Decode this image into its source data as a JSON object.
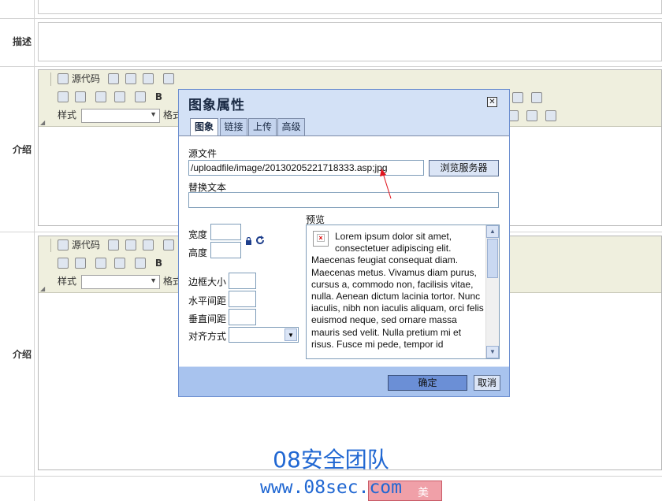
{
  "form": {
    "row_labels": [
      "描述",
      "介绍",
      "介绍"
    ],
    "editor_toolbar": {
      "source_label": "源代码",
      "bold_label": "B",
      "style_label": "样式",
      "format_label": "格式"
    }
  },
  "dialog": {
    "title": "图象属性",
    "close_symbol": "✕",
    "tabs": [
      "图象",
      "链接",
      "上传",
      "高级"
    ],
    "source_label": "源文件",
    "source_value": "/uploadfile/image/20130205221718333.asp;jpg",
    "browse_button": "浏览服务器",
    "alt_label": "替换文本",
    "alt_value": "",
    "width_label": "宽度",
    "height_label": "高度",
    "width_value": "",
    "height_value": "",
    "border_label": "边框大小",
    "hspace_label": "水平间距",
    "vspace_label": "垂直间距",
    "align_label": "对齐方式",
    "align_value": "",
    "preview_label": "预览",
    "preview_text": "Lorem ipsum dolor sit amet, consectetuer adipiscing elit. Maecenas feugiat consequat diam. Maecenas metus. Vivamus diam purus, cursus a, commodo non, facilisis vitae, nulla. Aenean dictum lacinia tortor. Nunc iaculis, nibh non iaculis aliquam, orci felis euismod neque, sed ornare massa mauris sed velit. Nulla pretium mi et risus. Fusce mi pede, tempor id",
    "ok_button": "确定",
    "cancel_button": "取消"
  },
  "watermark": {
    "team": "08安全团队",
    "url": "www.08sec.com",
    "badge_text": "美"
  },
  "colors": {
    "dialog_bg": "#d3e1f6",
    "dialog_footer": "#a8c3ee",
    "ok_button": "#6b8fd6",
    "watermark": "#2067d2",
    "annotation_arrow": "#e0141e"
  }
}
